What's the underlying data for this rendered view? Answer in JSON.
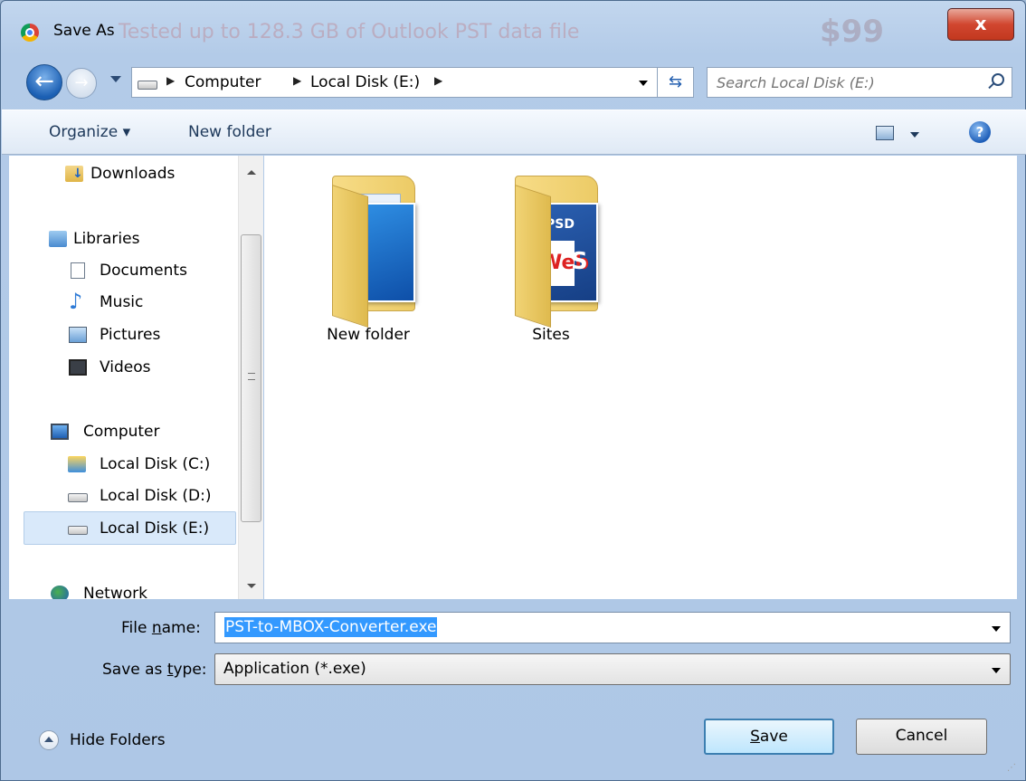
{
  "window": {
    "title": "Save As",
    "close_label": "x",
    "background_text": "Tested up to 128.3 GB of Outlook PST data file",
    "background_price": "$99"
  },
  "nav": {
    "breadcrumbs": [
      "Computer",
      "Local Disk (E:)"
    ],
    "search_placeholder": "Search Local Disk (E:)"
  },
  "toolbar": {
    "organize_label": "Organize ▾",
    "new_folder_label": "New folder",
    "help_label": "?"
  },
  "sidebar": {
    "items": [
      {
        "label": "Downloads",
        "icon": "downloads-icon"
      },
      {
        "label": "Libraries",
        "icon": "libraries-icon"
      },
      {
        "label": "Documents",
        "icon": "documents-icon"
      },
      {
        "label": "Music",
        "icon": "music-icon"
      },
      {
        "label": "Pictures",
        "icon": "pictures-icon"
      },
      {
        "label": "Videos",
        "icon": "videos-icon"
      },
      {
        "label": "Computer",
        "icon": "computer-icon"
      },
      {
        "label": "Local Disk (C:)",
        "icon": "local-disk-c-icon"
      },
      {
        "label": "Local Disk (D:)",
        "icon": "drive-icon"
      },
      {
        "label": "Local Disk (E:)",
        "icon": "drive-icon",
        "selected": true
      },
      {
        "label": "Network",
        "icon": "network-icon"
      }
    ]
  },
  "content": {
    "folders": [
      {
        "name": "New folder"
      },
      {
        "name": "Sites",
        "overlay": {
          "psd": "PSD",
          "web": "Web",
          "s": "S"
        }
      }
    ]
  },
  "form": {
    "filename_label_pre": "File ",
    "filename_label_u": "n",
    "filename_label_post": "ame:",
    "filename_value": "PST-to-MBOX-Converter.exe",
    "type_label_pre": "Save as ",
    "type_label_u": "t",
    "type_label_post": "ype:",
    "type_value": "Application (*.exe)",
    "hide_folders_label": "Hide Folders",
    "save_label_u": "S",
    "save_label_post": "ave",
    "cancel_label": "Cancel"
  },
  "colors": {
    "selection": "#3399ff",
    "frame": "#b3cbe8",
    "close_button": "#d1462f"
  }
}
